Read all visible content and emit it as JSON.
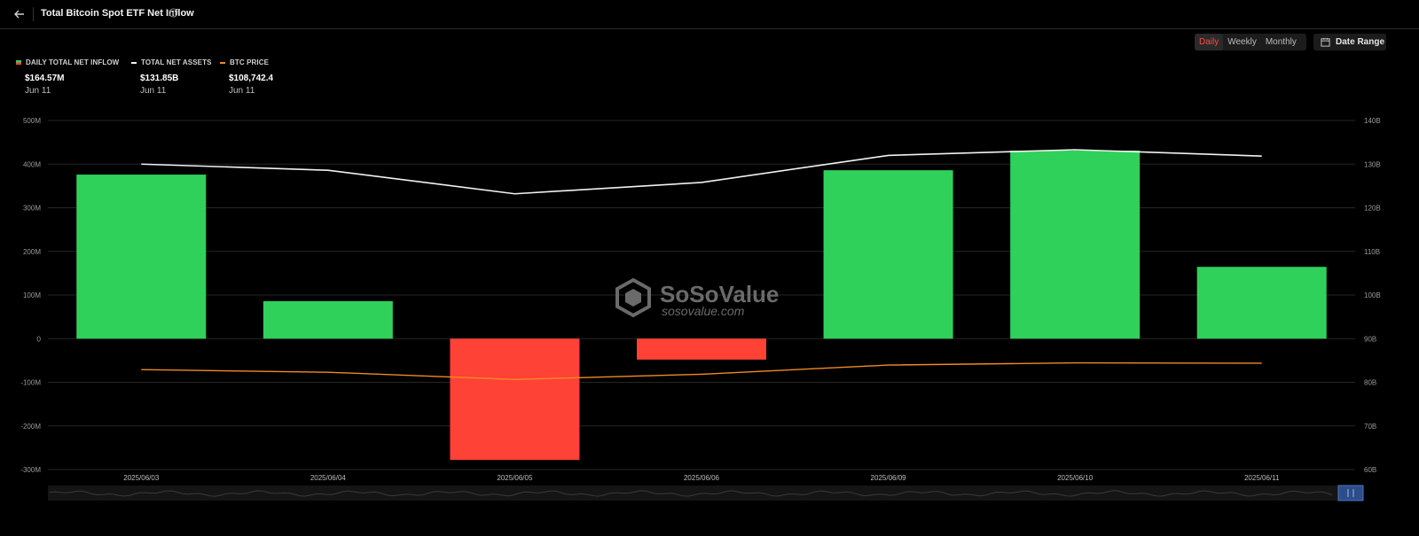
{
  "header": {
    "title": "Total Bitcoin Spot ETF Net Inflow"
  },
  "controls": {
    "periods": [
      "Daily",
      "Weekly",
      "Monthly"
    ],
    "active_period": "Daily",
    "date_range_label": "Date Range"
  },
  "legend": [
    {
      "label": "DAILY TOTAL NET INFLOW",
      "value": "$164.57M",
      "date": "Jun 11",
      "color": "#2fd15b"
    },
    {
      "label": "TOTAL NET ASSETS",
      "value": "$131.85B",
      "date": "Jun 11",
      "color": "#f2f2f2"
    },
    {
      "label": "BTC PRICE",
      "value": "$108,742.4",
      "date": "Jun 11",
      "color": "#f08a24"
    }
  ],
  "watermark": {
    "brand": "SoSoValue",
    "site": "sosovalue.com"
  },
  "chart_data": {
    "type": "bar",
    "categories": [
      "2025/06/03",
      "2025/06/04",
      "2025/06/05",
      "2025/06/06",
      "2025/06/09",
      "2025/06/10",
      "2025/06/11"
    ],
    "series": [
      {
        "name": "DAILY TOTAL NET INFLOW",
        "type": "bar",
        "axis": "left",
        "values": [
          376,
          86,
          -278,
          -48,
          386,
          431,
          164.57
        ],
        "positive_color": "#2fd15b",
        "negative_color": "#ff4136"
      },
      {
        "name": "TOTAL NET ASSETS",
        "type": "line",
        "axis": "right",
        "values": [
          130.0,
          128.6,
          123.2,
          125.8,
          132.0,
          133.3,
          131.85
        ],
        "color": "#f2f2f2"
      },
      {
        "name": "BTC PRICE",
        "type": "line",
        "axis": "hidden",
        "values": [
          105800,
          104600,
          101300,
          103700,
          107900,
          108900,
          108742.4
        ],
        "color": "#f08a24"
      }
    ],
    "left_axis": {
      "ticks": [
        "500M",
        "400M",
        "300M",
        "200M",
        "100M",
        "0",
        "-100M",
        "-200M",
        "-300M"
      ],
      "ylim": [
        -300,
        500
      ]
    },
    "right_axis": {
      "ticks": [
        "140B",
        "130B",
        "120B",
        "110B",
        "100B",
        "90B",
        "80B",
        "70B",
        "60B"
      ],
      "ylim": [
        60,
        140
      ]
    },
    "btc_range": [
      60000,
      220000
    ],
    "grid": true,
    "legend_position": "top-left"
  }
}
